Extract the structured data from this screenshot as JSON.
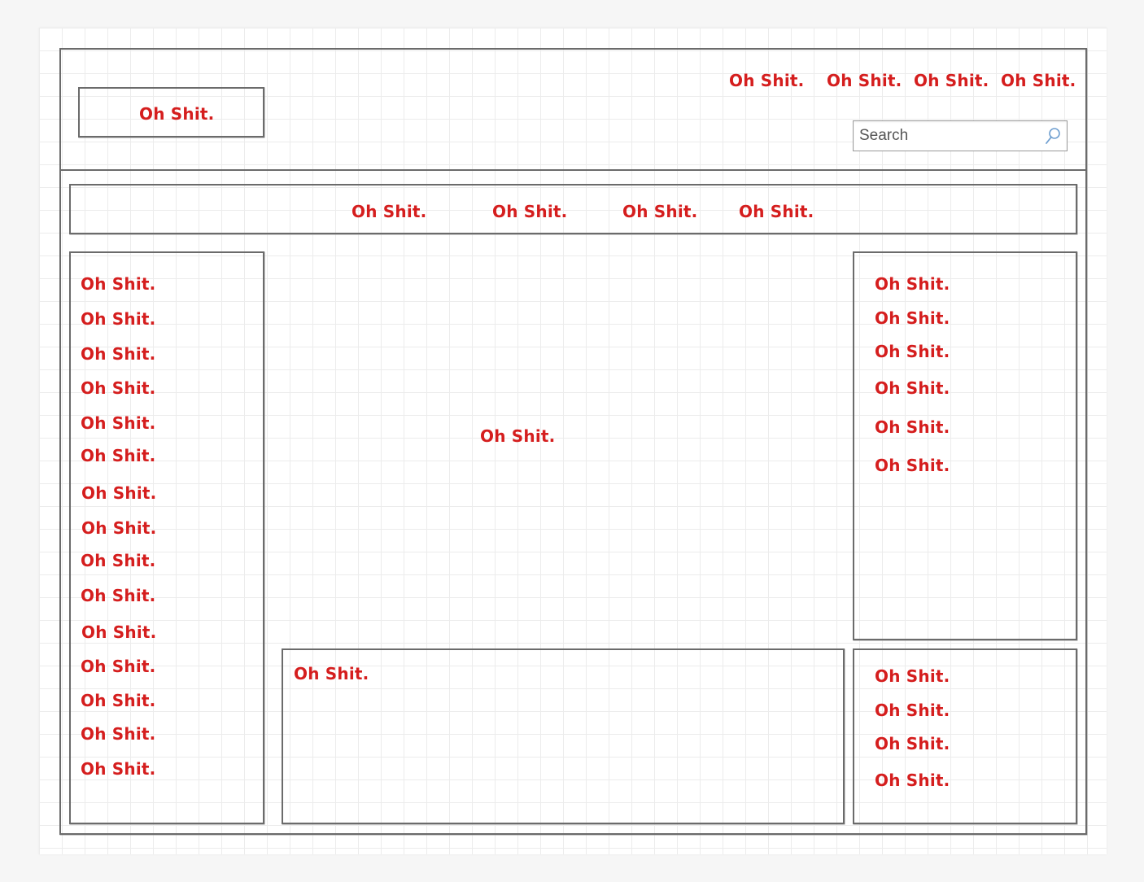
{
  "header": {
    "logo_label": "Oh Shit.",
    "top_nav": [
      "Oh Shit.",
      "Oh Shit.",
      "Oh Shit.",
      "Oh Shit."
    ],
    "search": {
      "placeholder": "Search",
      "value": "",
      "icon": "search-icon"
    }
  },
  "main_nav": [
    "Oh Shit.",
    "Oh Shit.",
    "Oh Shit.",
    "Oh Shit."
  ],
  "left_sidebar": [
    "Oh Shit.",
    "Oh Shit.",
    "Oh Shit.",
    "Oh Shit.",
    "Oh Shit.",
    "Oh Shit.",
    "Oh Shit.",
    "Oh Shit.",
    "Oh Shit.",
    "Oh Shit.",
    "Oh Shit.",
    "Oh Shit.",
    "Oh Shit.",
    "Oh Shit.",
    "Oh Shit."
  ],
  "content": {
    "main_text": "Oh Shit.",
    "bottom_text": "Oh Shit."
  },
  "right_sidebar_top": [
    "Oh Shit.",
    "Oh Shit.",
    "Oh Shit.",
    "Oh Shit.",
    "Oh Shit.",
    "Oh Shit."
  ],
  "right_sidebar_bottom": [
    "Oh Shit.",
    "Oh Shit.",
    "Oh Shit.",
    "Oh Shit."
  ],
  "colors": {
    "label": "#d51e1e",
    "line": "#6b6b6b",
    "grid": "#ececec"
  }
}
